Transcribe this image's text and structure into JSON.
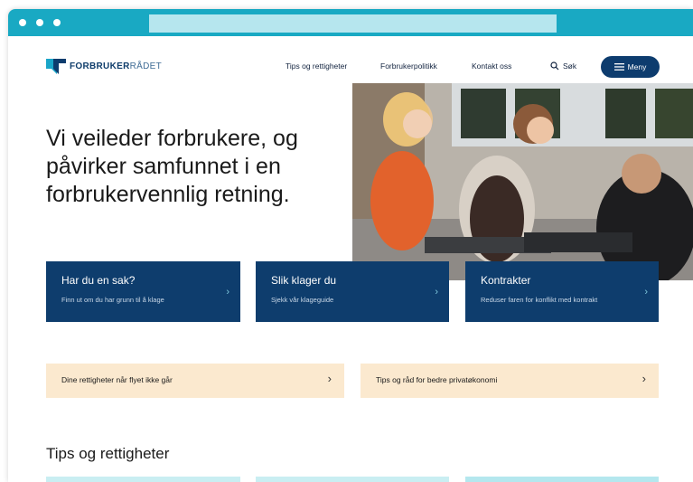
{
  "logo": {
    "bold": "FORBRUKER",
    "light": "RÅDET"
  },
  "nav": {
    "items": [
      "Tips og rettigheter",
      "Forbrukerpolitikk",
      "Kontakt oss"
    ],
    "search_label": "Søk",
    "menu_label": "Meny"
  },
  "hero": {
    "headline": "Vi veileder forbrukere, og påvirker samfunnet i en forbrukervennlig retning."
  },
  "cards": [
    {
      "title": "Har du en sak?",
      "subtitle": "Finn ut om du har grunn til å klage"
    },
    {
      "title": "Slik klager du",
      "subtitle": "Sjekk vår klageguide"
    },
    {
      "title": "Kontrakter",
      "subtitle": "Reduser faren for konflikt med kontrakt"
    }
  ],
  "links": [
    {
      "label": "Dine rettigheter når flyet ikke går"
    },
    {
      "label": "Tips og råd for bedre privatøkonomi"
    }
  ],
  "section": {
    "title": "Tips og rettigheter"
  },
  "colors": {
    "chrome": "#19a9c3",
    "brand_navy": "#0e3d6d",
    "beige": "#fbe9cf",
    "teal_light": "#c9eef2"
  }
}
